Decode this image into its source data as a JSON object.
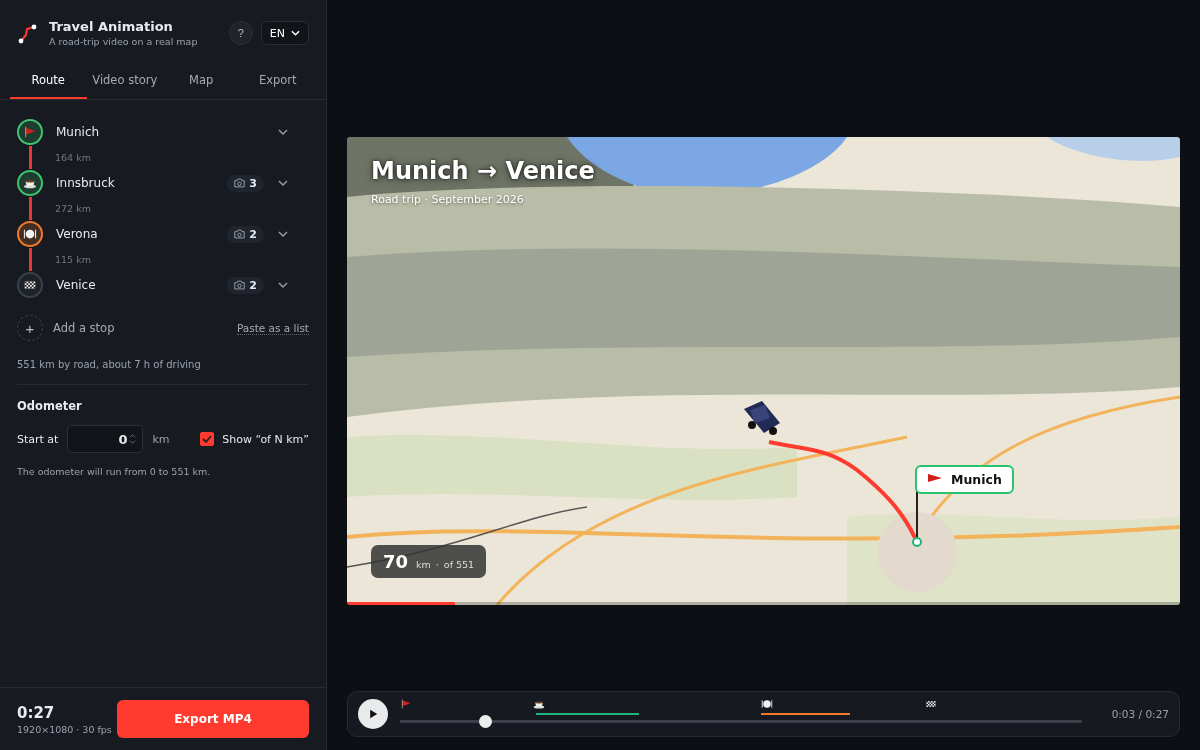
{
  "app": {
    "title": "Travel Animation",
    "subtitle": "A road-trip video on a real map",
    "help": "?",
    "language": "EN"
  },
  "tabs": [
    {
      "label": "Route",
      "selected": true
    },
    {
      "label": "Video story",
      "selected": false
    },
    {
      "label": "Map",
      "selected": false
    },
    {
      "label": "Export",
      "selected": false
    }
  ],
  "stops": [
    {
      "name": "Munich",
      "kind": "start",
      "color": "#3ec46d",
      "leg": "164 km"
    },
    {
      "name": "Innsbruck",
      "kind": "cafe",
      "color": "#3ec46d",
      "photos": "3",
      "leg": "272 km"
    },
    {
      "name": "Verona",
      "kind": "meal",
      "color": "#f07a2a",
      "photos": "2",
      "leg": "115 km"
    },
    {
      "name": "Venice",
      "kind": "finish",
      "color": "#3a414c",
      "photos": "2"
    }
  ],
  "add_stop": {
    "icon": "+",
    "label": "Add a stop"
  },
  "paste_link": "Paste as a list",
  "summary": "551 km by road, about 7 h of driving",
  "odometer": {
    "title": "Odometer",
    "start_label": "Start at",
    "start_value": "0",
    "unit": "km",
    "show_total": {
      "label": "Show “of N km”",
      "checked": true
    },
    "note": "The odometer will run from 0 to 551 km."
  },
  "footer": {
    "duration": "0:27",
    "format": "1920×1080 · 30 fps",
    "export": "Export MP4"
  },
  "video": {
    "title": "Munich → Venice",
    "subtitle": "Road trip · September 2026",
    "odometer": {
      "value": "70",
      "unit": "km",
      "separator": "·",
      "total": "of 551"
    },
    "marker": "Munich",
    "progress": {
      "level": 0.13
    }
  },
  "player": {
    "time": "0:03 / 0:27",
    "level": 0.124
  }
}
